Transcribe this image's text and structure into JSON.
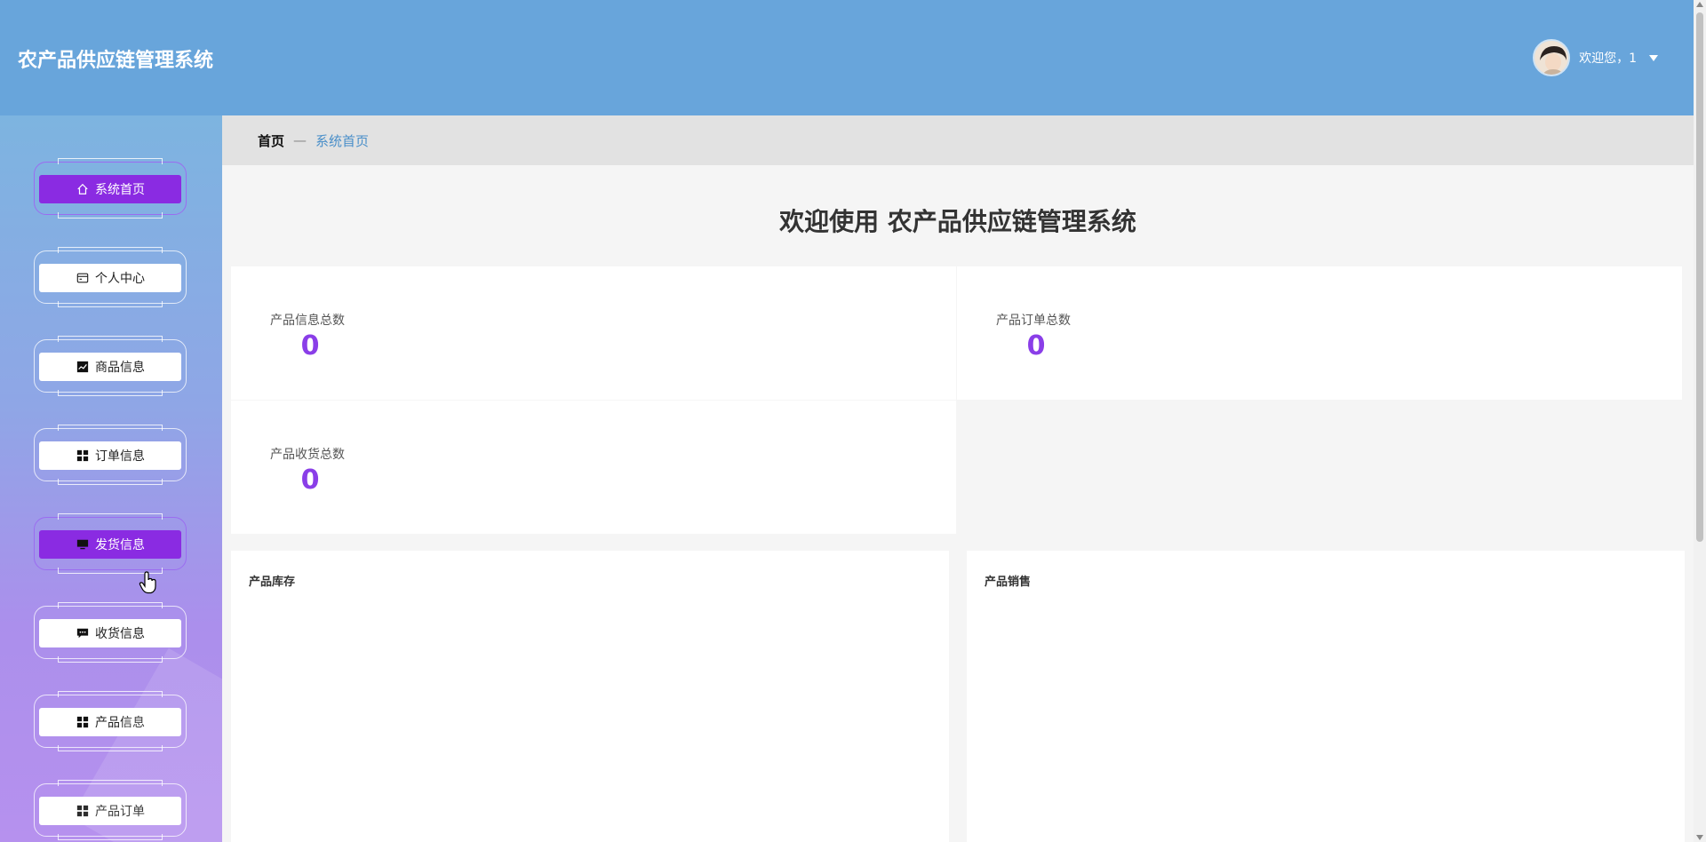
{
  "app": {
    "title": "农产品供应链管理系统"
  },
  "user": {
    "greeting": "欢迎您，1"
  },
  "sidebar": {
    "items": [
      {
        "label": "系统首页",
        "icon": "home-icon"
      },
      {
        "label": "个人中心",
        "icon": "card-icon"
      },
      {
        "label": "商品信息",
        "icon": "chart-line-icon"
      },
      {
        "label": "订单信息",
        "icon": "grid-icon"
      },
      {
        "label": "发货信息",
        "icon": "monitor-icon"
      },
      {
        "label": "收货信息",
        "icon": "message-icon"
      },
      {
        "label": "产品信息",
        "icon": "grid-icon"
      },
      {
        "label": "产品订单",
        "icon": "grid-icon"
      }
    ]
  },
  "breadcrumb": {
    "home": "首页",
    "separator": "—",
    "current": "系统首页"
  },
  "main": {
    "welcome": "欢迎使用 农产品供应链管理系统",
    "stats": [
      {
        "label": "产品信息总数",
        "value": "0"
      },
      {
        "label": "产品订单总数",
        "value": "0"
      },
      {
        "label": "产品收货总数",
        "value": "0"
      }
    ],
    "panels": [
      {
        "title": "产品库存"
      },
      {
        "title": "产品销售"
      }
    ]
  },
  "colors": {
    "header": "#68a5db",
    "accent": "#8a2be2",
    "stat_value": "#8a3ee8",
    "breadcrumb_current": "#4a8fc9"
  }
}
